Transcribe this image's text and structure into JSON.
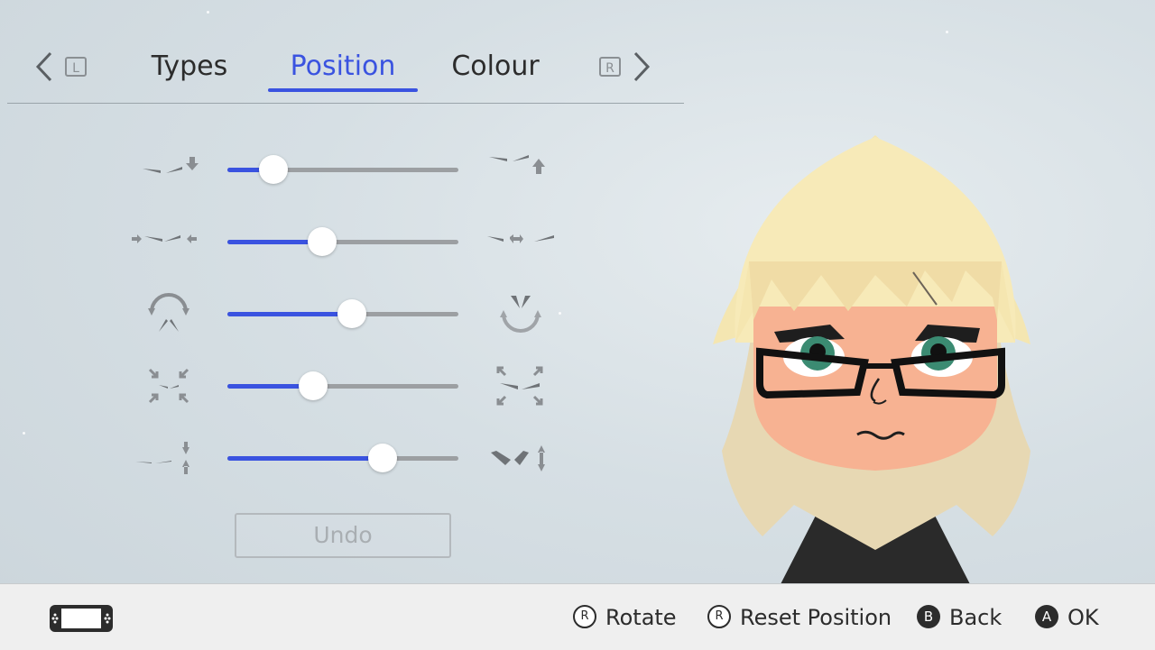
{
  "tabs": {
    "items": [
      {
        "label": "Types",
        "active": false
      },
      {
        "label": "Position",
        "active": true
      },
      {
        "label": "Colour",
        "active": false
      }
    ],
    "left_key": "L",
    "right_key": "R"
  },
  "sliders": [
    {
      "name": "eyebrow-vertical-position",
      "left_icon": "eyebrows-down-icon",
      "right_icon": "eyebrows-up-icon",
      "value": 0.2
    },
    {
      "name": "eyebrow-spacing",
      "left_icon": "eyebrows-closer-icon",
      "right_icon": "eyebrows-apart-icon",
      "value": 0.41
    },
    {
      "name": "eyebrow-rotation",
      "left_icon": "rotate-down-icon",
      "right_icon": "rotate-up-icon",
      "value": 0.54
    },
    {
      "name": "eyebrow-size",
      "left_icon": "shrink-icon",
      "right_icon": "enlarge-icon",
      "value": 0.37
    },
    {
      "name": "eyebrow-thickness",
      "left_icon": "thin-icon",
      "right_icon": "thick-icon",
      "value": 0.67
    }
  ],
  "undo_label": "Undo",
  "footer": {
    "hints": [
      {
        "glyph": "R",
        "label": "Rotate"
      },
      {
        "glyph": "R",
        "label": "Reset Position"
      },
      {
        "glyph": "B",
        "label": "Back"
      },
      {
        "glyph": "A",
        "label": "OK"
      }
    ]
  },
  "colors": {
    "accent": "#3a53e0",
    "track": "#9c9fa2",
    "text": "#2c2c2c",
    "footer_bg": "#efefef"
  }
}
